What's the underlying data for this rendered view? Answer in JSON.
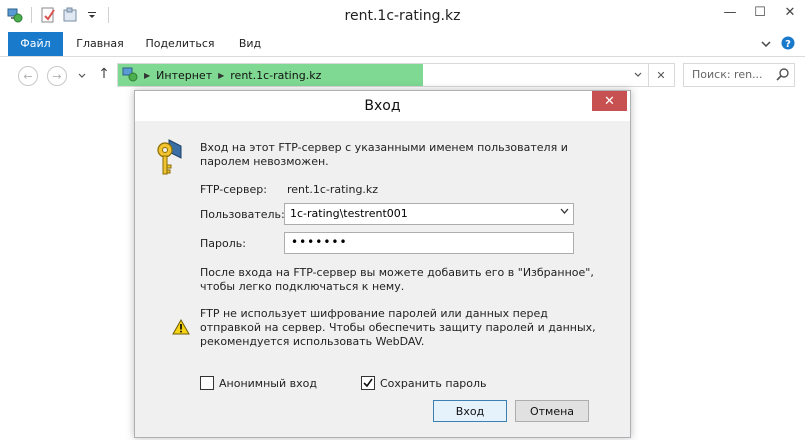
{
  "window": {
    "title": "rent.1c-rating.kz",
    "controls": {
      "minimize": "—",
      "maximize": "☐",
      "close": "✕"
    }
  },
  "ribbon": {
    "tabs": [
      "Файл",
      "Главная",
      "Поделиться",
      "Вид"
    ],
    "expand_icon": "chevron-down-icon",
    "help_icon": "help-icon"
  },
  "address_bar": {
    "segments": [
      "Интернет",
      "rent.1c-rating.kz"
    ],
    "highlight_color": "#7fd993"
  },
  "search": {
    "placeholder": "Поиск: ren..."
  },
  "dialog": {
    "title": "Вход",
    "message": "Вход на этот FTP-сервер  с указанными именем пользователя и паролем невозможен.",
    "server_label": "FTP-сервер:",
    "server_value": "rent.1c-rating.kz",
    "user_label": "Пользователь:",
    "user_value": "1c-rating\\testrent001",
    "password_label": "Пароль:",
    "password_value": "•••••••",
    "info_favorites": "После входа на FTP-сервер вы можете добавить его в \"Избранное\", чтобы легко подключаться к нему.",
    "info_security": "FTP не использует шифрование паролей или данных перед отправкой на сервер. Чтобы обеспечить защиту паролей и данных, рекомендуется использовать WebDAV.",
    "anonymous_label": "Анонимный вход",
    "anonymous_checked": false,
    "save_password_label": "Сохранить пароль",
    "save_password_checked": true,
    "ok_label": "Вход",
    "cancel_label": "Отмена",
    "close_color": "#c75050"
  }
}
